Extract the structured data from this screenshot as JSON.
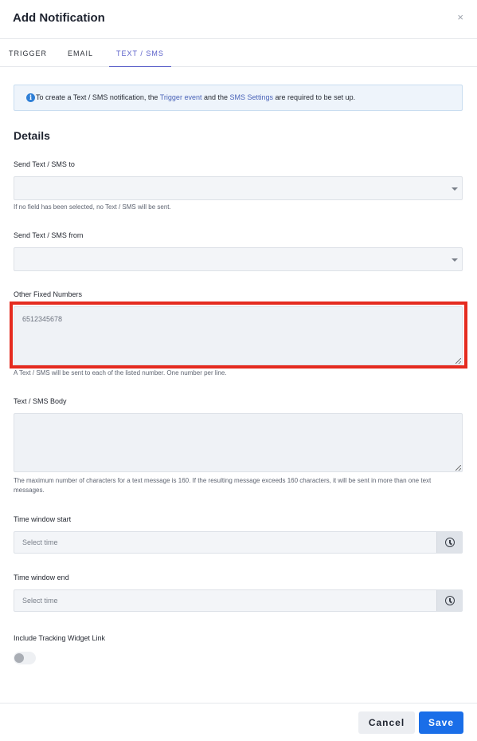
{
  "header": {
    "title": "Add Notification",
    "close_symbol": "×"
  },
  "tabs": [
    {
      "label": "TRIGGER",
      "active": false
    },
    {
      "label": "EMAIL",
      "active": false
    },
    {
      "label": "TEXT / SMS",
      "active": true
    }
  ],
  "info": {
    "icon": "info-icon",
    "text_before": "To create a Text / SMS notification, the ",
    "link1": "Trigger event",
    "text_middle": " and the ",
    "link2": "SMS Settings",
    "text_after": " are required to be set up."
  },
  "details": {
    "title": "Details",
    "send_to": {
      "label": "Send Text / SMS to",
      "value": "",
      "help": "If no field has been selected, no Text / SMS will be sent."
    },
    "send_from": {
      "label": "Send Text / SMS from",
      "value": ""
    },
    "other_numbers": {
      "label": "Other Fixed Numbers",
      "placeholder": "6512345678",
      "help": "A Text / SMS will be sent to each of the listed number. One number per line."
    },
    "body": {
      "label": "Text / SMS Body",
      "value": "",
      "help": "The maximum number of characters for a text message is 160. If the resulting message exceeds 160 characters, it will be sent in more than one text messages."
    },
    "time_start": {
      "label": "Time window start",
      "placeholder": "Select time"
    },
    "time_end": {
      "label": "Time window end",
      "placeholder": "Select time"
    },
    "tracking": {
      "label": "Include Tracking Widget Link",
      "enabled": false
    }
  },
  "footer": {
    "cancel_label": "Cancel",
    "save_label": "Save"
  },
  "colors": {
    "accent": "#5a5fc9",
    "primary_button": "#1a6ee8",
    "highlight": "#e52b1f"
  }
}
